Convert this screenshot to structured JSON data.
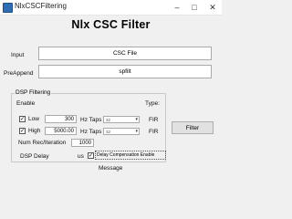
{
  "window": {
    "title": "NlxCSCFiltering",
    "minimize": "–",
    "maximize": "□",
    "close": "✕"
  },
  "header": {
    "title": "Nlx CSC Filter"
  },
  "input": {
    "label": "Input",
    "value": "CSC File"
  },
  "preappend": {
    "label": "PreAppend",
    "value": "spfilt"
  },
  "dsp": {
    "group_title": "DSP Filtering",
    "enable_label": "Enable",
    "type_label": "Type:",
    "low": {
      "label": "Low",
      "checked": true,
      "freq": "300",
      "taps_label": "Hz Taps",
      "taps": "32",
      "type": "FIR"
    },
    "high": {
      "label": "High",
      "checked": true,
      "freq": "5000.00",
      "taps_label": "Hz Taps",
      "taps": "32",
      "type": "FIR"
    },
    "num_rec": {
      "label": "Num Rec/Iteration",
      "value": "1000"
    },
    "delay": {
      "label": "DSP Delay",
      "unit": "us",
      "comp_label": "Delay Compensation Enable",
      "comp_checked": true
    }
  },
  "filter_button": {
    "label": "Filter"
  },
  "message": {
    "label": "Message"
  }
}
